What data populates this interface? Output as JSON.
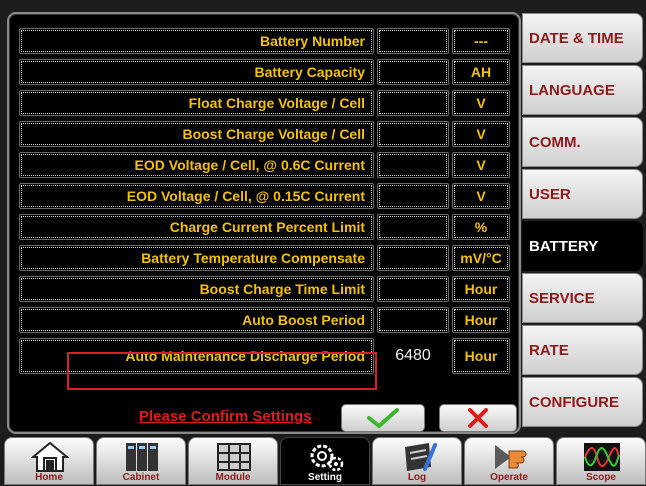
{
  "battery_table": {
    "rows": [
      {
        "label": "Battery Number",
        "value": "",
        "unit": "---"
      },
      {
        "label": "Battery Capacity",
        "value": "",
        "unit": "AH"
      },
      {
        "label": "Float Charge Voltage / Cell",
        "value": "",
        "unit": "V"
      },
      {
        "label": "Boost Charge Voltage / Cell",
        "value": "",
        "unit": "V"
      },
      {
        "label": "EOD Voltage / Cell, @ 0.6C Current",
        "value": "",
        "unit": "V"
      },
      {
        "label": "EOD Voltage / Cell, @ 0.15C Current",
        "value": "",
        "unit": "V"
      },
      {
        "label": "Charge Current Percent Limit",
        "value": "",
        "unit": "%"
      },
      {
        "label": "Battery Temperature Compensate",
        "value": "",
        "unit": "mV/°C"
      },
      {
        "label": "Boost Charge Time Limit",
        "value": "",
        "unit": "Hour"
      },
      {
        "label": "Auto Boost Period",
        "value": "",
        "unit": "Hour"
      },
      {
        "label": "Auto Maintenance Discharge Period",
        "value": "6480",
        "unit": "Hour"
      }
    ]
  },
  "confirm": {
    "text": "Please Confirm Settings",
    "ok_symbol": "✓",
    "cancel_symbol": "✕"
  },
  "tabs": [
    {
      "label": "DATE & TIME",
      "active": false
    },
    {
      "label": "LANGUAGE",
      "active": false
    },
    {
      "label": "COMM.",
      "active": false
    },
    {
      "label": "USER",
      "active": false
    },
    {
      "label": "BATTERY",
      "active": true
    },
    {
      "label": "SERVICE",
      "active": false
    },
    {
      "label": "RATE",
      "active": false
    },
    {
      "label": "CONFIGURE",
      "active": false
    }
  ],
  "bottom_nav": [
    {
      "label": "Home",
      "icon": "home-icon",
      "active": false
    },
    {
      "label": "Cabinet",
      "icon": "cabinet-icon",
      "active": false
    },
    {
      "label": "Module",
      "icon": "module-icon",
      "active": false
    },
    {
      "label": "Setting",
      "icon": "gears-icon",
      "active": true
    },
    {
      "label": "Log",
      "icon": "log-icon",
      "active": false
    },
    {
      "label": "Operate",
      "icon": "hand-pointer-icon",
      "active": false
    },
    {
      "label": "Scope",
      "icon": "waveform-icon",
      "active": false
    }
  ],
  "colors": {
    "label": "#f2c200",
    "accent_red": "#d8202a",
    "tab_text": "#8e1a1a",
    "ok_green": "#3cb82e"
  }
}
